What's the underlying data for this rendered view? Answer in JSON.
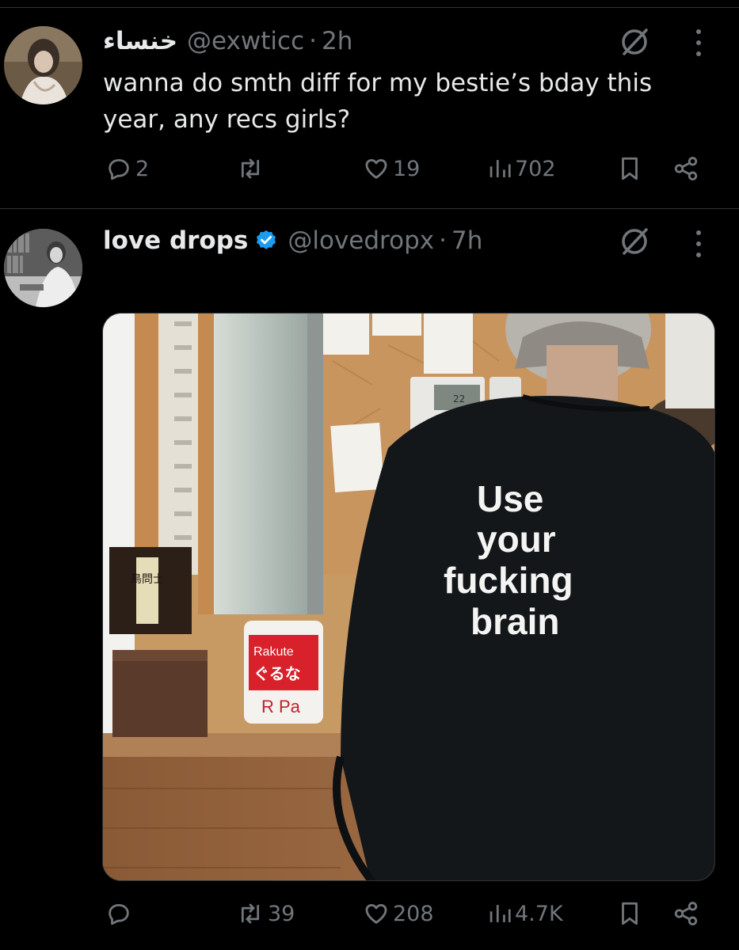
{
  "tweets": [
    {
      "name": "خنساء",
      "handle": "@exwticc",
      "separator": "·",
      "time": "2h",
      "text": "wanna do smth diff for my bestie’s bday this year, any recs girls?",
      "verified": false,
      "stats": {
        "replies": "2",
        "reposts": "",
        "likes": "19",
        "views": "702"
      }
    },
    {
      "name": "love drops",
      "handle": "@lovedropx",
      "separator": "·",
      "time": "7h",
      "verified": true,
      "media": {
        "shirt_text": [
          "Use",
          "your",
          "fucking",
          "brain"
        ],
        "sign_brand": "Rakute",
        "sign_sub": "ぐるな",
        "sign_bottom": "R Pa",
        "box_label": "鳥問士",
        "display_temp": "22"
      },
      "stats": {
        "replies": "",
        "reposts": "39",
        "likes": "208",
        "views": "4.7K"
      }
    }
  ],
  "icons": {
    "grok": "grok-slash-icon",
    "more": "more-vertical-icon",
    "reply": "reply-icon",
    "repost": "repost-icon",
    "like": "heart-icon",
    "views": "views-bar-chart-icon",
    "bookmark": "bookmark-icon",
    "share": "share-icon",
    "verified": "verified-badge-icon"
  },
  "colors": {
    "background": "#000000",
    "text": "#e7e9ea",
    "muted": "#71767b",
    "divider": "#2f3336",
    "verified": "#1d9bf0"
  }
}
